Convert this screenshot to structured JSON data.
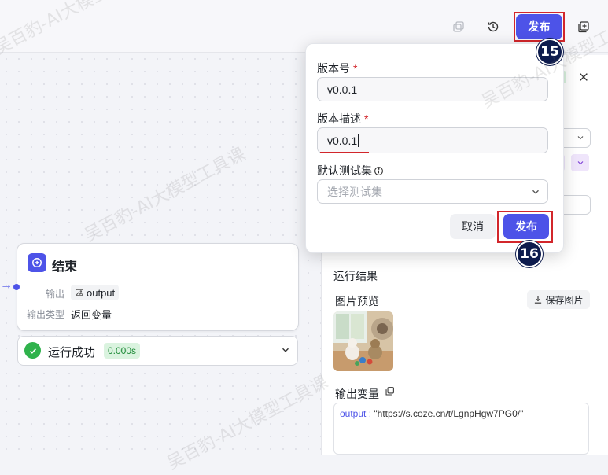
{
  "header": {
    "publish_label": "发布"
  },
  "popup": {
    "version_label": "版本号",
    "version_value": "v0.0.1",
    "desc_label": "版本描述",
    "desc_value": "v0.0.1",
    "required_mark": "*",
    "testset_label": "默认测试集",
    "testset_placeholder": "选择测试集",
    "cancel_label": "取消",
    "publish_label": "发布"
  },
  "steps": {
    "step15": "15",
    "step16": "16"
  },
  "end_node": {
    "title": "结束",
    "output_label": "输出",
    "output_chip": "output",
    "output_type_label": "输出类型",
    "output_type_value": "返回变量"
  },
  "run_status": {
    "text": "运行成功",
    "time": "0.000s"
  },
  "right_panel": {
    "run_result_label": "运行结果",
    "image_preview_label": "图片预览",
    "save_image_label": "保存图片",
    "output_var_label": "输出变量",
    "output_key": "output",
    "output_value": "\"https://s.coze.cn/t/LgnpHgw7PG0/\""
  },
  "watermark": "吴百豹-AI大模型工具课",
  "colors": {
    "primary": "#4d53e8",
    "highlight_red": "#d2262b",
    "success": "#2fb24c"
  }
}
